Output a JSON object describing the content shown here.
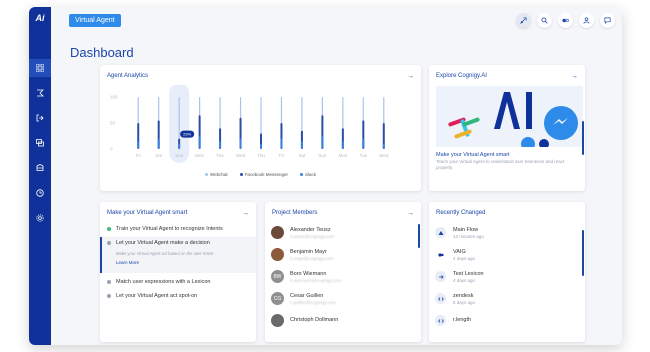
{
  "app": {
    "logo": "Ai",
    "badge": "Virtual Agent",
    "page_title": "Dashboard"
  },
  "colors": {
    "sidebar": "#10319a",
    "accent": "#1b46a8",
    "badge": "#2f8bea",
    "webchat": "#a9c3ef",
    "messenger": "#2b4da6",
    "slack": "#3a80e0"
  },
  "sidebar": {
    "icons": [
      "grid-icon",
      "flows-icon",
      "exit-icon",
      "chat-icon",
      "database-icon",
      "analytics-icon",
      "settings-icon"
    ]
  },
  "topbar": {
    "icons": [
      "rocket-icon",
      "search-icon",
      "toggle-icon",
      "user-icon",
      "message-icon"
    ]
  },
  "analytics": {
    "title": "Agent Analytics",
    "tooltip": "29%",
    "legend": [
      "Webchat",
      "Facebook Messenger",
      "Slack"
    ],
    "y_ticks": [
      "100",
      "50",
      "0"
    ]
  },
  "chart_data": {
    "type": "bar",
    "title": "Agent Analytics",
    "categories": [
      "Fri",
      "Sat",
      "Sun",
      "Mon",
      "Tue",
      "Wed",
      "Thu",
      "Fri",
      "Sat",
      "Sun",
      "Mon",
      "Tue",
      "Wed"
    ],
    "series": [
      {
        "name": "Webchat",
        "values": [
          100,
          100,
          100,
          100,
          100,
          100,
          100,
          100,
          100,
          100,
          100,
          100,
          100
        ]
      },
      {
        "name": "Facebook Messenger",
        "values": [
          50,
          55,
          20,
          65,
          40,
          60,
          30,
          50,
          35,
          65,
          40,
          55,
          50
        ]
      },
      {
        "name": "Slack",
        "values": [
          15,
          20,
          10,
          25,
          15,
          20,
          10,
          20,
          15,
          25,
          15,
          20,
          10
        ]
      }
    ],
    "ylim": [
      0,
      100
    ],
    "highlight_index": 2,
    "legend_position": "bottom"
  },
  "explore": {
    "title": "Explore Cognigy.AI",
    "promo_title": "Make your Virtual Agent smart",
    "promo_desc": "Teach your Virtual Agent to understand user Intentions and react properly."
  },
  "smart": {
    "title": "Make your Virtual Agent smart",
    "steps": [
      {
        "label": "Train your Virtual Agent to recognize Intents",
        "color": "#3cc07a"
      },
      {
        "label": "Let your Virtual Agent make a decision",
        "color": "#9aa3b2",
        "desc": "Make your Virtual Agent act based on the user Intent",
        "link": "Learn More"
      },
      {
        "label": "Match user expressions with a Lexicon",
        "color": "#9aa3b2"
      },
      {
        "label": "Let your Virtual Agent act spot-on",
        "color": "#9aa3b2"
      }
    ]
  },
  "members": {
    "title": "Project Members",
    "list": [
      {
        "name": "Alexander Teusz",
        "email": "a.teusz@cognigy.com",
        "initials": "",
        "color": "#6b4a3a"
      },
      {
        "name": "Benjamin Mayr",
        "email": "b.mayr@cognigy.com",
        "initials": "",
        "color": "#8a5a3a"
      },
      {
        "name": "Boro Wiemann",
        "email": "b.wiemann@cognigy.com",
        "initials": "BW",
        "color": "#8f8f8f"
      },
      {
        "name": "Cesar Guillen",
        "email": "c.guillen@cognigy.com",
        "initials": "CG",
        "color": "#8f8f8f"
      },
      {
        "name": "Christoph Dollmann",
        "email": "",
        "initials": "",
        "color": "#6a6a6a"
      }
    ]
  },
  "recent": {
    "title": "Recently Changed",
    "list": [
      {
        "name": "Main Flow",
        "time": "13 minutes ago",
        "icon": "flow-icon"
      },
      {
        "name": "VAIG",
        "time": "4 days ago",
        "icon": "intent-icon"
      },
      {
        "name": "Test Lexicon",
        "time": "4 days ago",
        "icon": "lexicon-icon"
      },
      {
        "name": "zendesk",
        "time": "5 days ago",
        "icon": "code-icon"
      },
      {
        "name": "r.length",
        "time": "",
        "icon": "code-icon"
      }
    ]
  }
}
